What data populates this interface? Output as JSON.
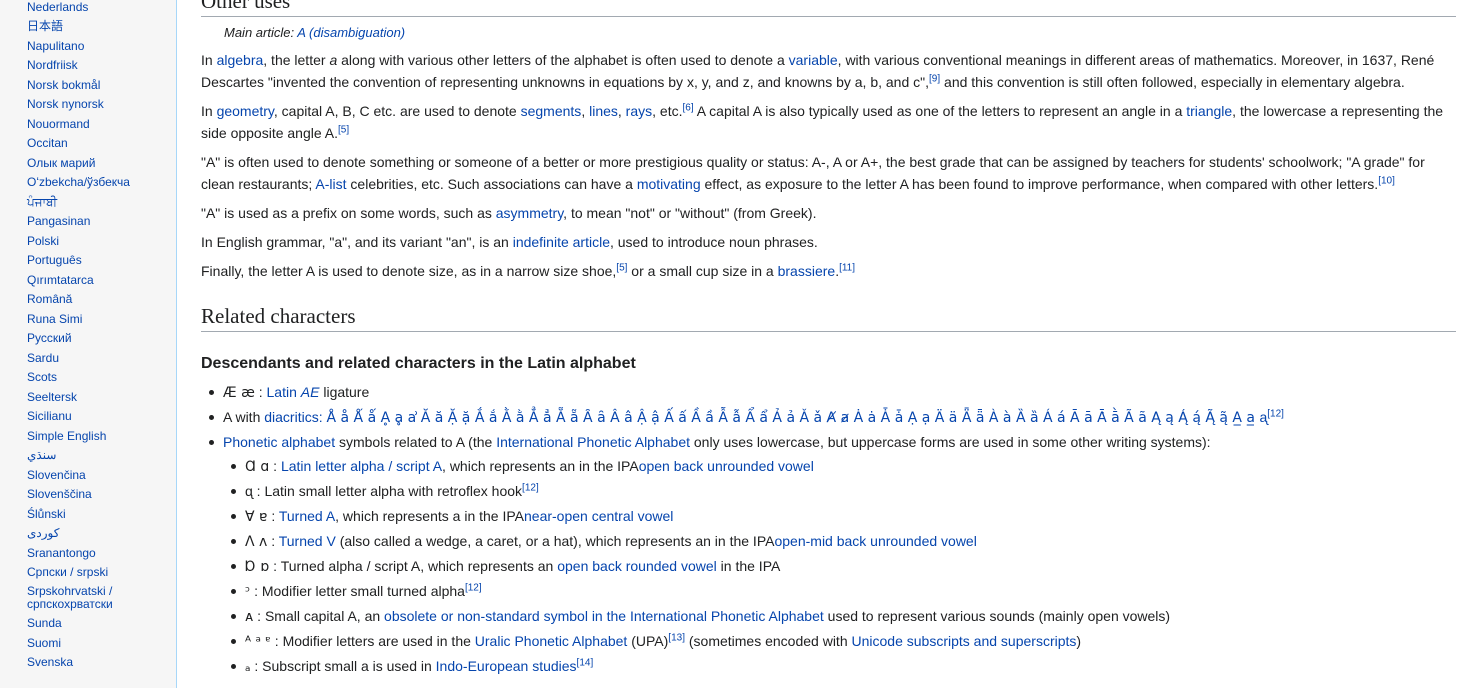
{
  "languages": [
    "Nederlands",
    "日本語",
    "Napulitano",
    "Nordfriisk",
    "Norsk bokmål",
    "Norsk nynorsk",
    "Nouormand",
    "Occitan",
    "Олык марий",
    "Oʻzbekcha/ўзбекча",
    "ਪੰਜਾਬੀ",
    "Pangasinan",
    "Polski",
    "Português",
    "Qırımtatarca",
    "Română",
    "Runa Simi",
    "Русский",
    "Sardu",
    "Scots",
    "Seeltersk",
    "Sicilianu",
    "Simple English",
    "سنڌي",
    "Slovenčina",
    "Slovenščina",
    "Ślůnski",
    "کوردی",
    "Sranantongo",
    "Српски / srpski",
    "Srpskohrvatski / српскохрватски",
    "Sunda",
    "Suomi",
    "Svenska"
  ],
  "other_uses": {
    "heading": "Other uses",
    "hatnote_prefix": "Main article: ",
    "hatnote_link": "A (disambiguation)",
    "p1": {
      "t1": "In ",
      "l1": "algebra",
      "t2": ", the letter ",
      "italic_a": "a",
      "t3": " along with various other letters of the alphabet is often used to denote a ",
      "l2": "variable",
      "t4": ", with various conventional meanings in different areas of mathematics. Moreover, in 1637, René Descartes \"invented the convention of representing unknowns in equations by x, y, and z, and knowns by a, b, and c\",",
      "ref": "[9]",
      "t5": " and this convention is still often followed, especially in elementary algebra."
    },
    "p2": {
      "t1": "In ",
      "l1": "geometry",
      "t2": ", capital A, B, C etc. are used to denote ",
      "l2": "segments",
      "t3": ", ",
      "l3": "lines",
      "t4": ", ",
      "l4": "rays",
      "t5": ", etc.",
      "ref1": "[6]",
      "t6": " A capital A is also typically used as one of the letters to represent an angle in a ",
      "l5": "triangle",
      "t7": ", the lowercase a representing the side opposite angle A.",
      "ref2": "[5]"
    },
    "p3": {
      "t1": "\"A\" is often used to denote something or someone of a better or more prestigious quality or status: A-, A or A+, the best grade that can be assigned by teachers for students' schoolwork; \"A grade\" for clean restaurants; ",
      "l1": "A-list",
      "t2": " celebrities, etc. Such associations can have a ",
      "l2": "motivating",
      "t3": " effect, as exposure to the letter A has been found to improve performance, when compared with other letters.",
      "ref": "[10]"
    },
    "p4": {
      "t1": "\"A\" is used as a prefix on some words, such as ",
      "l1": "asymmetry",
      "t2": ", to mean \"not\" or \"without\" (from Greek)."
    },
    "p5": {
      "t1": "In English grammar, \"a\", and its variant \"an\", is an ",
      "l1": "indefinite article",
      "t2": ", used to introduce noun phrases."
    },
    "p6": {
      "t1": "Finally, the letter A is used to denote size, as in a narrow size shoe,",
      "ref1": "[5]",
      "t2": " or a small cup size in a ",
      "l1": "brassiere",
      "t3": ".",
      "ref2": "[11]"
    }
  },
  "related": {
    "heading": "Related characters",
    "subheading": "Descendants and related characters in the Latin alphabet",
    "item_ae": {
      "glyph": "Æ æ",
      "t1": " : ",
      "l1": "Latin ",
      "l1_italic": "AE",
      "t2": " ligature"
    },
    "item_diacritics": {
      "t1": "A with ",
      "l1": "diacritics",
      "t2": ": ",
      "glyphs": "Å å Ǻ ǻ Ḁ ḁ ẚ Ă ă Ặ ặ Ắ ắ Ằ ằ Ẳ ẳ Ẵ ẵ Ȃ ȃ Â â Ậ ậ Ấ ấ Ầ ầ Ẫ ẫ Ẩ ẩ Ả ả Ǎ ǎ Ⱥ ⱥ Ȧ ȧ Ǡ ǡ Ạ ạ Ä ä Ǟ ǟ À à Ȁ ȁ Á á Ā ā Ā̀ ā̀ Ã ã Ą ą Ą́ ą́ Ą̃ ą̃ A̲ a̲ ᶏ",
      "ref": "[12]"
    },
    "item_phonetic": {
      "l1": "Phonetic alphabet",
      "t1": " symbols related to A (the ",
      "l2": "International Phonetic Alphabet",
      "t2": " only uses lowercase, but uppercase forms are used in some other writing systems):"
    },
    "sub_items": [
      {
        "glyph": "Ɑ ɑ",
        "t1": " : ",
        "l1": "Latin letter alpha / script A",
        "t2": ", which represents an ",
        "l2": "open back unrounded vowel",
        "t3": " in the IPA",
        "ref": ""
      },
      {
        "glyph": "ᶐ",
        "t1": " : Latin small letter alpha with retroflex hook",
        "l1": "",
        "t2": "",
        "l2": "",
        "t3": "",
        "ref": "[12]"
      },
      {
        "glyph": "Ɐ ɐ",
        "t1": " : ",
        "l1": "Turned A",
        "t2": ", which represents a ",
        "l2": "near-open central vowel",
        "t3": " in the IPA",
        "ref": ""
      },
      {
        "glyph": "Ʌ ʌ",
        "t1": " : ",
        "l1": "Turned V",
        "t2": " (also called a wedge, a caret, or a hat), which represents an ",
        "l2": "open-mid back unrounded vowel",
        "t3": " in the IPA",
        "ref": ""
      },
      {
        "glyph": "Ɒ ɒ",
        "t1": " : Turned alpha / script A, which represents an ",
        "l1": "open back rounded vowel",
        "t2": " in the IPA",
        "l2": "",
        "t3": "",
        "ref": ""
      },
      {
        "glyph": "ᵓ",
        "t1": " : Modifier letter small turned alpha",
        "l1": "",
        "t2": "",
        "l2": "",
        "t3": "",
        "ref": "[12]"
      },
      {
        "glyph": "ᴀ",
        "t1": " : Small capital A, an ",
        "l1": "obsolete or non-standard symbol in the International Phonetic Alphabet",
        "t2": " used to represent various sounds (mainly open vowels)",
        "l2": "",
        "t3": "",
        "ref": ""
      },
      {
        "glyph": "ᴬ ᵃ ᵄ",
        "t1": " : Modifier letters are used in the ",
        "l1": "Uralic Phonetic Alphabet",
        "t2": " (UPA)",
        "ref_mid": "[13]",
        "t3": " (sometimes encoded with ",
        "l2": "Unicode subscripts and superscripts",
        "t4": ")",
        "ref": ""
      },
      {
        "glyph": "ₐ",
        "t1": " : Subscript small a is used in ",
        "l1": "Indo-European studies",
        "t2": "",
        "l2": "",
        "t3": "",
        "ref": "[14]"
      }
    ]
  }
}
